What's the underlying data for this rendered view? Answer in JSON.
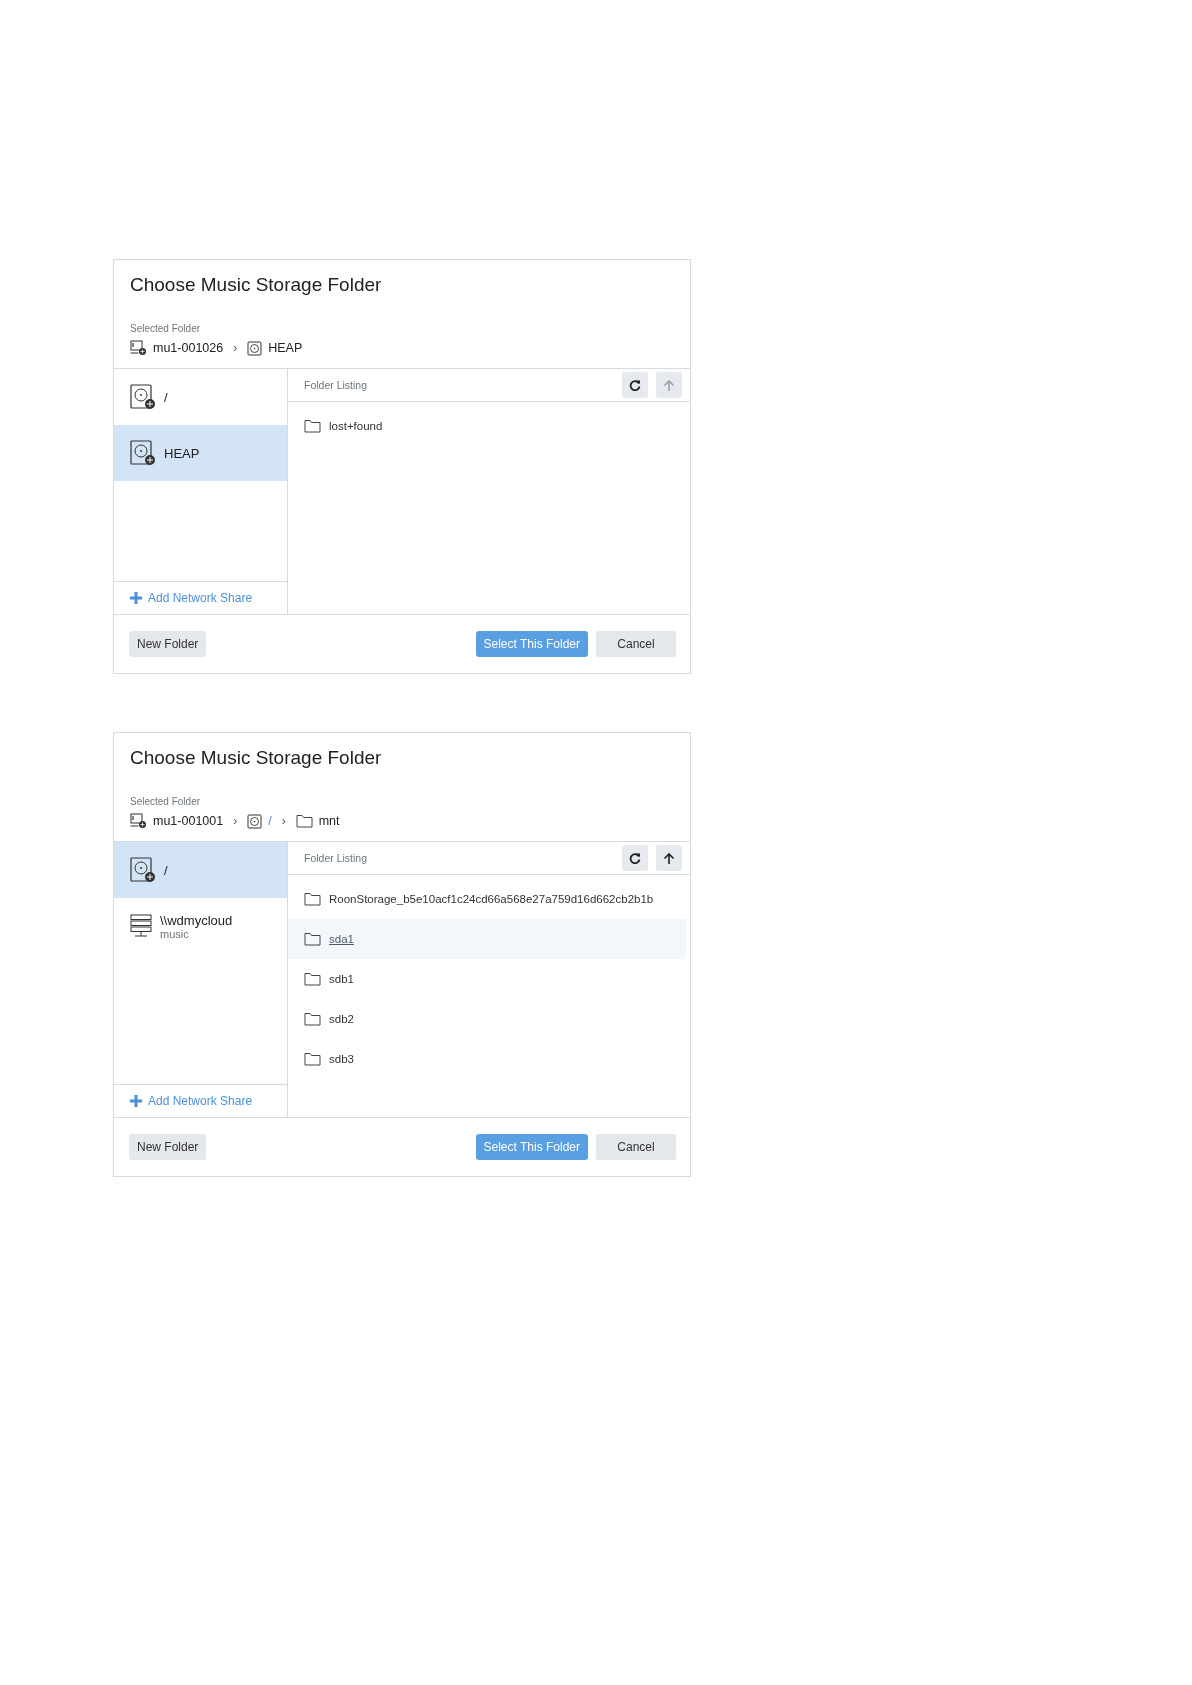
{
  "dialogs": [
    {
      "title": "Choose Music Storage Folder",
      "selected_label": "Selected Folder",
      "breadcrumb": [
        {
          "kind": "computer",
          "label": "mu1-001026",
          "link": false
        },
        {
          "kind": "separator",
          "label": "›"
        },
        {
          "kind": "drive",
          "label": "HEAP",
          "link": false
        }
      ],
      "sources": [
        {
          "kind": "drive",
          "name": "/",
          "selected": false
        },
        {
          "kind": "drive",
          "name": "HEAP",
          "selected": true
        }
      ],
      "add_share": "Add Network Share",
      "listing_label": "Folder Listing",
      "up_disabled": true,
      "folders": [
        {
          "name": "lost+found",
          "hovered": false
        }
      ],
      "buttons": {
        "new_folder": "New Folder",
        "select": "Select This Folder",
        "cancel": "Cancel"
      }
    },
    {
      "title": "Choose Music Storage Folder",
      "selected_label": "Selected Folder",
      "breadcrumb": [
        {
          "kind": "computer",
          "label": "mu1-001001",
          "link": false
        },
        {
          "kind": "separator",
          "label": "›"
        },
        {
          "kind": "drive",
          "label": "/",
          "link": true
        },
        {
          "kind": "separator",
          "label": "›"
        },
        {
          "kind": "folder",
          "label": "mnt",
          "link": false
        }
      ],
      "sources": [
        {
          "kind": "drive",
          "name": "/",
          "selected": true
        },
        {
          "kind": "share",
          "name": "\\\\wdmycloud",
          "subtitle": "music",
          "selected": false
        }
      ],
      "add_share": "Add Network Share",
      "listing_label": "Folder Listing",
      "up_disabled": false,
      "folders": [
        {
          "name": "RoonStorage_b5e10acf1c24cd66a568e27a759d16d662cb2b1b",
          "hovered": false
        },
        {
          "name": "sda1",
          "hovered": true
        },
        {
          "name": "sdb1",
          "hovered": false
        },
        {
          "name": "sdb2",
          "hovered": false
        },
        {
          "name": "sdb3",
          "hovered": false
        }
      ],
      "buttons": {
        "new_folder": "New Folder",
        "select": "Select This Folder",
        "cancel": "Cancel"
      }
    }
  ]
}
